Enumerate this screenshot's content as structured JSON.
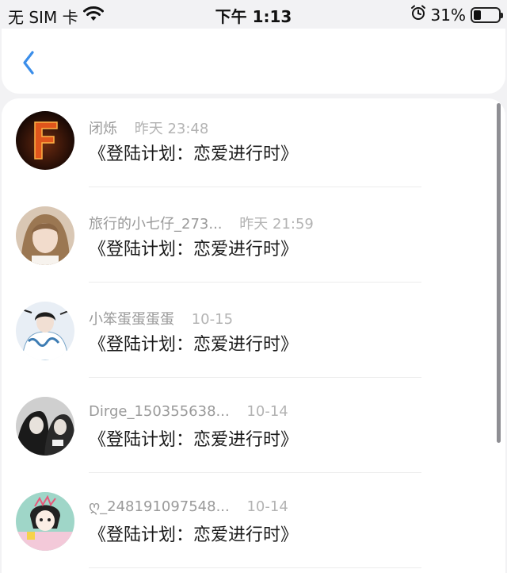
{
  "status_bar": {
    "carrier": "无 SIM 卡",
    "time": "下午 1:13",
    "battery": "31%",
    "battery_level": 0.31
  },
  "header": {
    "back_icon": "chevron-left-icon",
    "accent_color": "#3b8eea"
  },
  "items": [
    {
      "name": "闭烁",
      "time": "昨天 23:48",
      "title": "《登陆计划：恋爱进行时》"
    },
    {
      "name": "旅行的小七仔_273...",
      "time": "昨天 21:59",
      "title": "《登陆计划：恋爱进行时》"
    },
    {
      "name": "小笨蛋蛋蛋蛋",
      "time": "10-15",
      "title": "《登陆计划：恋爱进行时》"
    },
    {
      "name": "Dirge_150355638...",
      "time": "10-14",
      "title": "《登陆计划：恋爱进行时》"
    },
    {
      "name": "ღ_248191097548...",
      "time": "10-14",
      "title": "《登陆计划：恋爱进行时》"
    }
  ]
}
